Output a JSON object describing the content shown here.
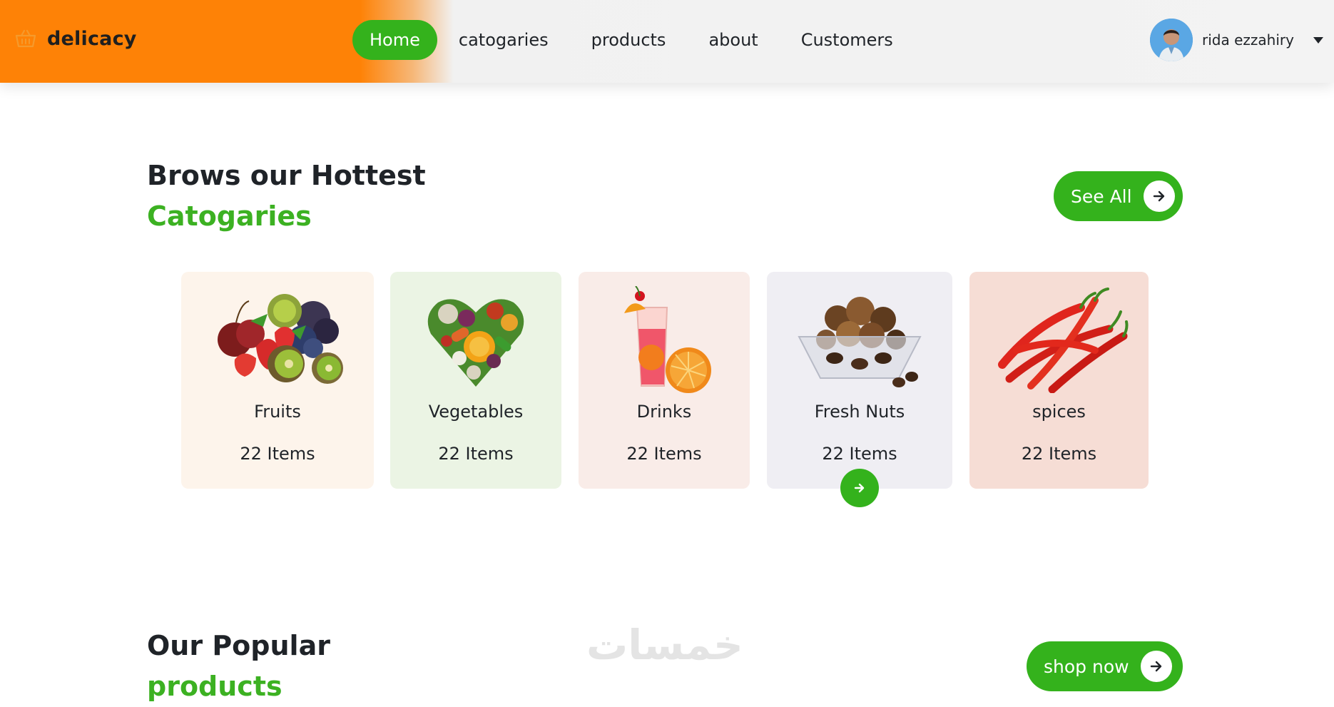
{
  "header": {
    "brand": {
      "name": "delicacy",
      "icon": "basket-icon"
    },
    "nav": [
      {
        "label": "Home",
        "active": true
      },
      {
        "label": "catogaries",
        "active": false
      },
      {
        "label": "products",
        "active": false
      },
      {
        "label": "about",
        "active": false
      },
      {
        "label": "Customers",
        "active": false
      }
    ],
    "user": {
      "name": "rida ezzahiry",
      "avatar_icon": "user-avatar",
      "menu_icon": "caret-down-icon"
    }
  },
  "categories_section": {
    "title_line1": "Brows our Hottest",
    "title_line2": "Catogaries",
    "see_all_label": "See All",
    "cards": [
      {
        "name": "Fruits",
        "count": "22 Items",
        "icon": "fruits-image",
        "bg": "#fdf4eb"
      },
      {
        "name": "Vegetables",
        "count": "22 Items",
        "icon": "vegetables-image",
        "bg": "#ebf4e4"
      },
      {
        "name": "Drinks",
        "count": "22 Items",
        "icon": "drinks-image",
        "bg": "#f9ece8"
      },
      {
        "name": "Fresh Nuts",
        "count": "22 Items",
        "icon": "nuts-image",
        "bg": "#efeef3"
      },
      {
        "name": "spices",
        "count": "22 Items",
        "icon": "chili-image",
        "bg": "#f6ddd5"
      }
    ],
    "next_icon": "arrow-right-icon"
  },
  "popular_section": {
    "title_line1": "Our Popular",
    "title_line2": "products",
    "shop_now_label": "shop now"
  },
  "watermark": "خمسات",
  "colors": {
    "accent": "#34b21c",
    "accent_text": "#3cb122",
    "brand_orange": "#fe8206"
  }
}
